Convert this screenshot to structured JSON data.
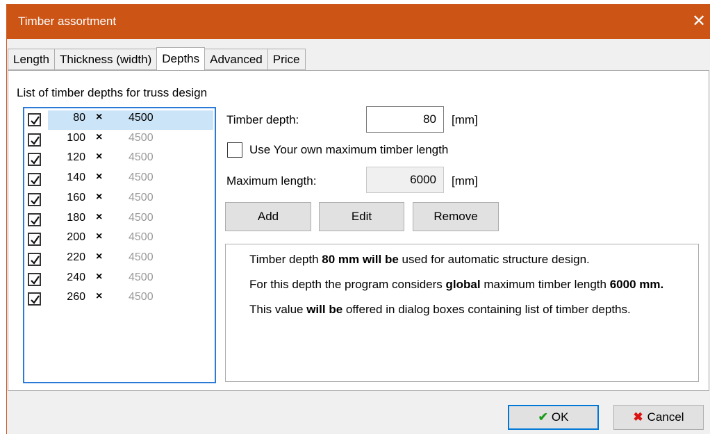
{
  "window": {
    "title": "Timber assortment",
    "close_glyph": "✕"
  },
  "tabs": [
    {
      "label": "Length"
    },
    {
      "label": "Thickness (width)"
    },
    {
      "label": "Depths"
    },
    {
      "label": "Advanced"
    },
    {
      "label": "Price"
    }
  ],
  "active_tab": "Depths",
  "list": {
    "caption": "List of timber depths for truss design",
    "rows": [
      {
        "checked": true,
        "depth": "80",
        "sep": "×",
        "length": "4500",
        "selected": true
      },
      {
        "checked": true,
        "depth": "100",
        "sep": "×",
        "length": "4500",
        "selected": false
      },
      {
        "checked": true,
        "depth": "120",
        "sep": "×",
        "length": "4500",
        "selected": false
      },
      {
        "checked": true,
        "depth": "140",
        "sep": "×",
        "length": "4500",
        "selected": false
      },
      {
        "checked": true,
        "depth": "160",
        "sep": "×",
        "length": "4500",
        "selected": false
      },
      {
        "checked": true,
        "depth": "180",
        "sep": "×",
        "length": "4500",
        "selected": false
      },
      {
        "checked": true,
        "depth": "200",
        "sep": "×",
        "length": "4500",
        "selected": false
      },
      {
        "checked": true,
        "depth": "220",
        "sep": "×",
        "length": "4500",
        "selected": false
      },
      {
        "checked": true,
        "depth": "240",
        "sep": "×",
        "length": "4500",
        "selected": false
      },
      {
        "checked": true,
        "depth": "260",
        "sep": "×",
        "length": "4500",
        "selected": false
      }
    ]
  },
  "form": {
    "depth_label": "Timber depth:",
    "depth_value": "80",
    "depth_unit": "[mm]",
    "own_length_label": "Use Your own maximum timber length",
    "own_length_checked": false,
    "max_length_label": "Maximum length:",
    "max_length_value": "6000",
    "max_length_unit": "[mm]"
  },
  "buttons": {
    "add": "Add",
    "edit": "Edit",
    "remove": "Remove",
    "ok": "OK",
    "cancel": "Cancel"
  },
  "info": {
    "p1_a": "Timber depth ",
    "p1_b": "80 mm will be",
    "p1_c": " used for automatic structure design.",
    "p2_a": "For this depth the program considers ",
    "p2_b": "global",
    "p2_c": " maximum timber length ",
    "p2_d": "6000 mm.",
    "p3_a": "This value ",
    "p3_b": "will be",
    "p3_c": " offered in dialog boxes containing list of timber depths."
  },
  "colors": {
    "titlebar": "#cc5415",
    "selection": "#cce4f7",
    "focus": "#2a7ad6",
    "ok_icon": "#1a9c1a",
    "cancel_icon": "#dd1111"
  }
}
